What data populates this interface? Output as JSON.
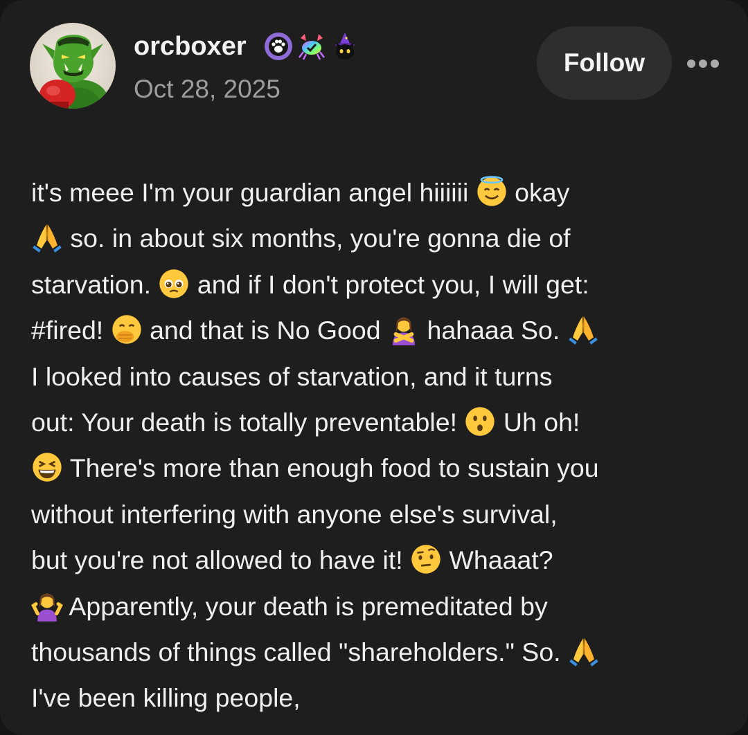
{
  "post": {
    "author": {
      "username": "orcboxer",
      "avatar_icon": "orc-boxer-avatar",
      "badges": [
        "paw-badge-icon",
        "crab-badge-icon",
        "wizard-cat-badge-icon"
      ]
    },
    "date": "Oct 28, 2025",
    "follow_label": "Follow",
    "more_icon": "ellipsis-icon",
    "body_lines": [
      [
        {
          "t": "it's meee I'm your guardian angel hiiiiii "
        },
        {
          "e": "halo"
        },
        {
          "t": " okay"
        }
      ],
      [
        {
          "e": "pray"
        },
        {
          "t": " so. in about six months, you're gonna die of"
        }
      ],
      [
        {
          "t": "starvation. "
        },
        {
          "e": "pleading"
        },
        {
          "t": " and if I don't protect you, I will get:"
        }
      ],
      [
        {
          "t": "#fired! "
        },
        {
          "e": "hand-over-mouth"
        },
        {
          "t": " and that is No Good "
        },
        {
          "e": "no-gesture"
        },
        {
          "t": " hahaaa So. "
        },
        {
          "e": "pray"
        }
      ],
      [
        {
          "t": "I looked into causes of starvation, and it turns"
        }
      ],
      [
        {
          "t": "out:  Your death is totally preventable! "
        },
        {
          "e": "hushed"
        },
        {
          "t": " Uh oh!"
        }
      ],
      [
        {
          "e": "squint-laugh"
        },
        {
          "t": " There's more than enough food to sustain you"
        }
      ],
      [
        {
          "t": "without interfering with anyone else's survival,"
        }
      ],
      [
        {
          "t": "but you're not allowed to have it! "
        },
        {
          "e": "raised-eyebrow"
        },
        {
          "t": " Whaaat?"
        }
      ],
      [
        {
          "e": "shrug"
        },
        {
          "t": " Apparently, your death is premeditated by"
        }
      ],
      [
        {
          "t": "thousands of things called \"shareholders.\" So. "
        },
        {
          "e": "pray"
        }
      ],
      [
        {
          "t": "I've been killing people,"
        }
      ]
    ]
  },
  "colors": {
    "background": "#1e1e1e",
    "text": "#efefef",
    "muted": "#9d9d9d",
    "button": "#2e2e2e"
  }
}
